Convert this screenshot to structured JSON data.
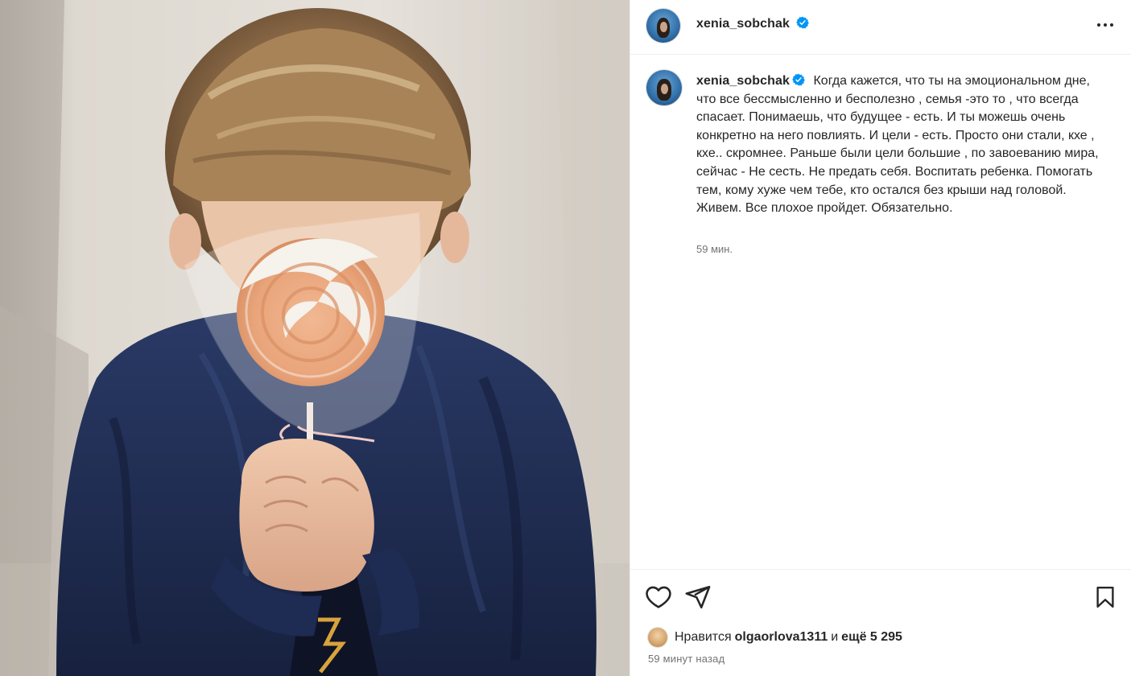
{
  "post": {
    "username": "xenia_sobchak",
    "verified": true,
    "caption": "Когда кажется, что ты на эмоциональном дне, что все бессмысленно и бесполезно , семья -это то , что всегда спасает. Понимаешь, что будущее - есть. И ты можешь очень конкретно на него повлиять. И цели - есть. Просто они стали, кхе , кхе.. скромнее. Раньше были цели большие , по завоеванию мира, сейчас - Не сесть. Не предать себя. Воспитать ребенка. Помогать тем, кому хуже чем тебе, кто остался без крыши над головой. Живем. Все плохое пройдет. Обязательно.",
    "caption_time": "59 мин.",
    "likes_prefix": "Нравится",
    "likes_user": "olgaorlova1311",
    "likes_connector": "и",
    "likes_rest": "ещё 5 295",
    "timestamp": "59 минут назад"
  },
  "icons": {
    "more": "more-options-icon",
    "verified": "verified-badge-icon",
    "like": "heart-icon",
    "share": "paper-plane-icon",
    "save": "bookmark-icon"
  },
  "colors": {
    "verified_blue": "#0095f6",
    "text": "#262626",
    "muted": "#737373",
    "divider": "#efefef"
  }
}
